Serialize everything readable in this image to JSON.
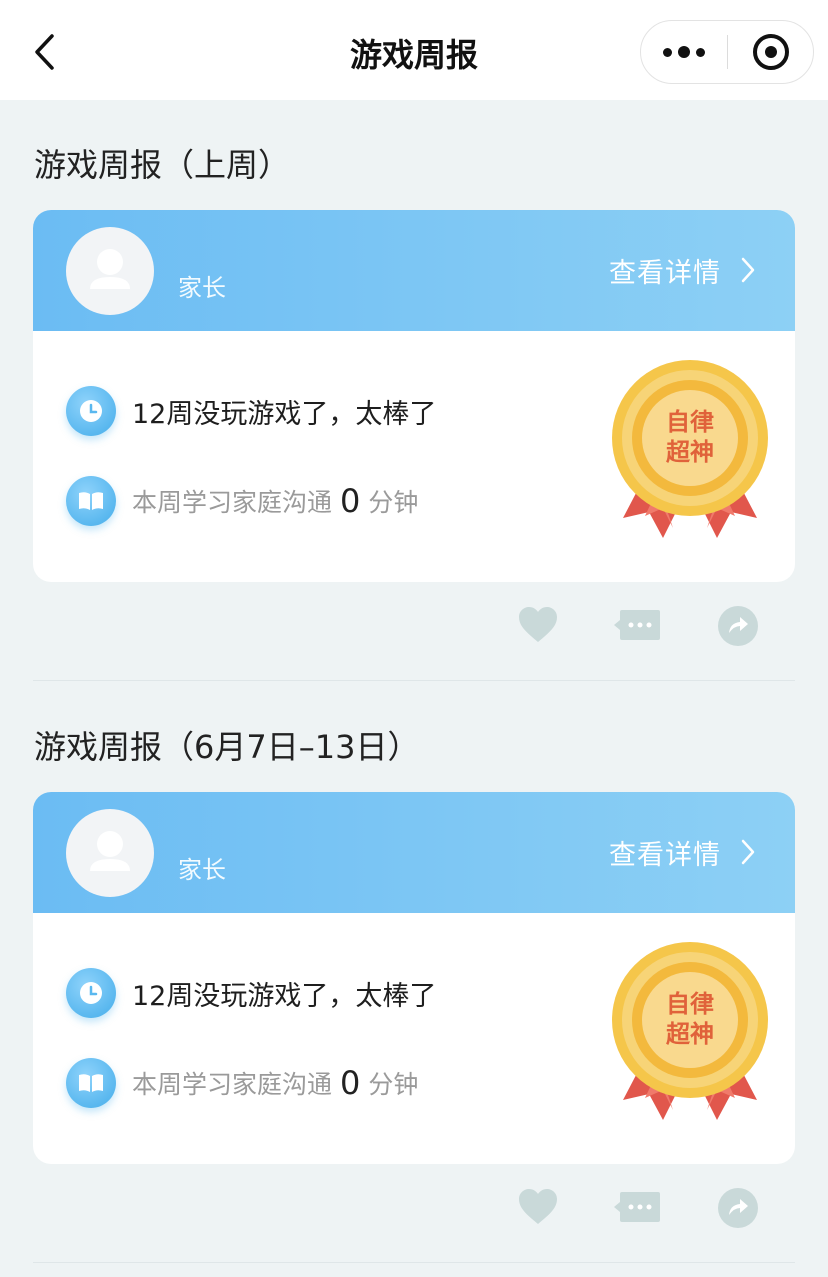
{
  "nav": {
    "title": "游戏周报"
  },
  "reports": [
    {
      "title": "游戏周报（上周）",
      "user": "家长",
      "detail_label": "查看详情",
      "game_text": "12周没玩游戏了，太棒了",
      "study_label": "本周学习家庭沟通",
      "study_value": "0",
      "study_unit": "分钟",
      "badge_line1": "自律",
      "badge_line2": "超神"
    },
    {
      "title": "游戏周报（6月7日–13日）",
      "user": "家长",
      "detail_label": "查看详情",
      "game_text": "12周没玩游戏了，太棒了",
      "study_label": "本周学习家庭沟通",
      "study_value": "0",
      "study_unit": "分钟",
      "badge_line1": "自律",
      "badge_line2": "超神"
    }
  ],
  "icons": {
    "back": "chevron-left-icon",
    "more": "more-dots-icon",
    "close": "target-close-icon",
    "clock": "clock-icon",
    "book": "book-icon",
    "like": "heart-icon",
    "comment": "comment-icon",
    "share": "share-icon"
  },
  "colors": {
    "accent": "#6bbcf3",
    "page_bg": "#eef3f4",
    "action_icon": "#c9d9d9"
  }
}
